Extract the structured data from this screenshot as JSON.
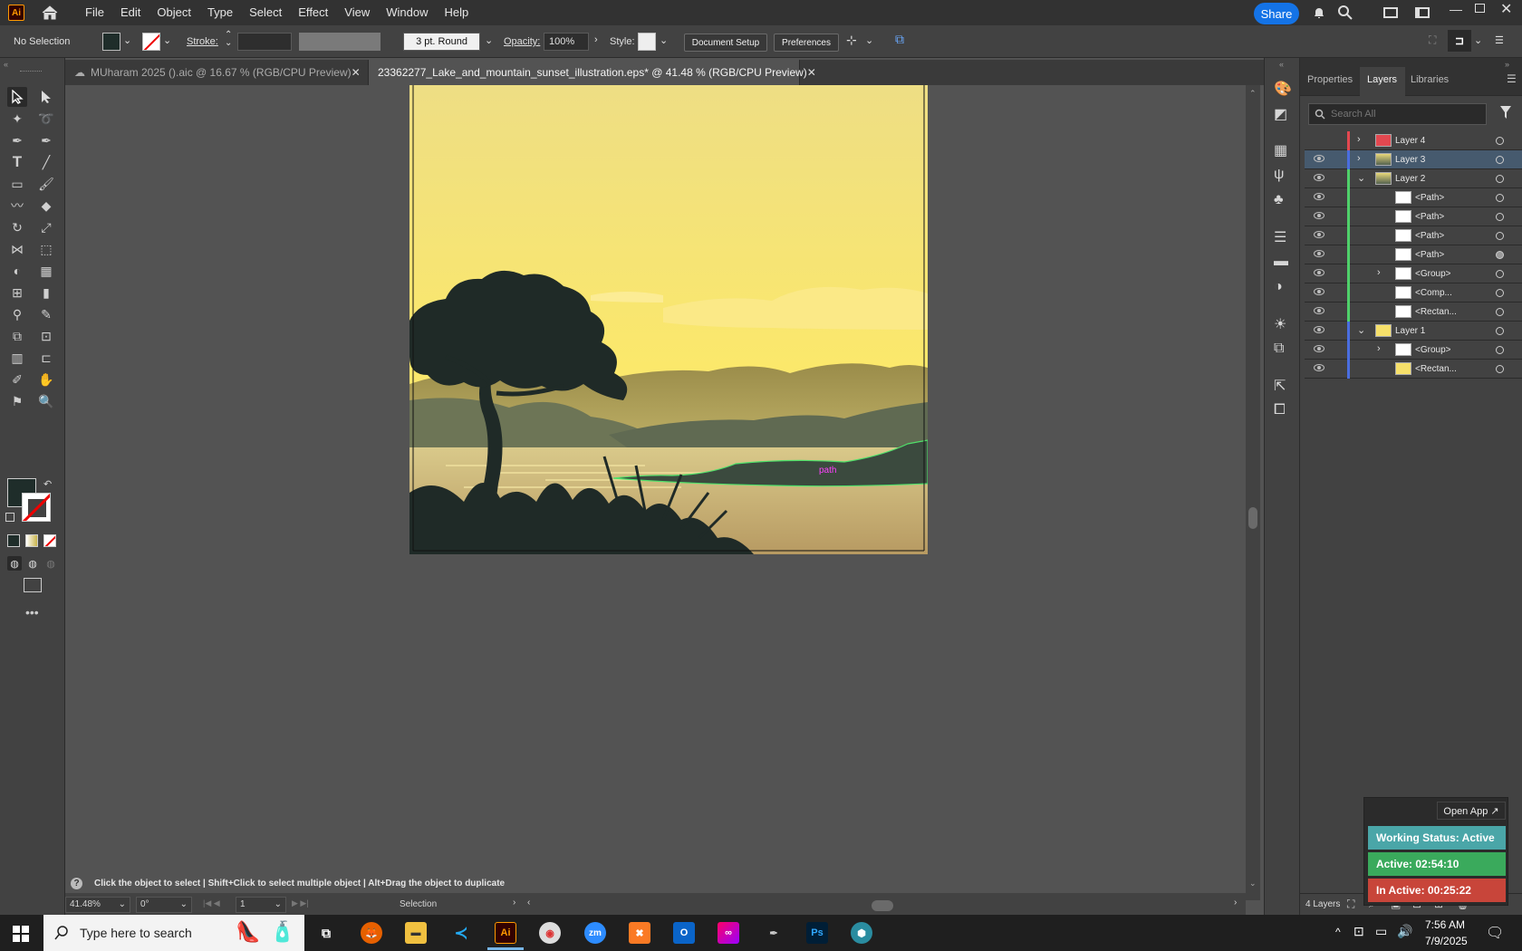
{
  "menubar": {
    "app_icon": "Ai",
    "items": [
      "File",
      "Edit",
      "Object",
      "Type",
      "Select",
      "Effect",
      "View",
      "Window",
      "Help"
    ],
    "share": "Share"
  },
  "controlbar": {
    "selection": "No Selection",
    "stroke_label": "Stroke:",
    "brush": "3 pt. Round",
    "opacity_label": "Opacity:",
    "opacity": "100%",
    "style_label": "Style:",
    "document_setup": "Document Setup",
    "preferences": "Preferences"
  },
  "tabs": [
    {
      "title": "MUharam 2025 ().aic @ 16.67 % (RGB/CPU Preview)",
      "active": false
    },
    {
      "title": "23362277_Lake_and_mountain_sunset_illustration.eps* @ 41.48 % (RGB/CPU Preview)",
      "active": true
    }
  ],
  "canvas": {
    "hover_label": "path"
  },
  "panel": {
    "tabs": [
      "Properties",
      "Layers",
      "Libraries"
    ],
    "active_tab": "Layers",
    "search_placeholder": "Search All",
    "layers": [
      {
        "name": "Layer 4",
        "color": "#e34850",
        "indent": 0,
        "expand": ">",
        "eye": false,
        "selected": false
      },
      {
        "name": "Layer 3",
        "color": "#4a6ee0",
        "indent": 0,
        "expand": ">",
        "eye": true,
        "selected": true
      },
      {
        "name": "Layer 2",
        "color": "#4fd16a",
        "indent": 0,
        "expand": "v",
        "eye": true,
        "selected": false
      },
      {
        "name": "<Path>",
        "color": "#4fd16a",
        "indent": 1,
        "expand": "",
        "eye": true,
        "selected": false
      },
      {
        "name": "<Path>",
        "color": "#4fd16a",
        "indent": 1,
        "expand": "",
        "eye": true,
        "selected": false
      },
      {
        "name": "<Path>",
        "color": "#4fd16a",
        "indent": 1,
        "expand": "",
        "eye": true,
        "selected": false
      },
      {
        "name": "<Path>",
        "color": "#4fd16a",
        "indent": 1,
        "expand": "",
        "eye": true,
        "selected": false
      },
      {
        "name": "<Group>",
        "color": "#4fd16a",
        "indent": 1,
        "expand": ">",
        "eye": true,
        "selected": false
      },
      {
        "name": "<Comp...",
        "color": "#4fd16a",
        "indent": 1,
        "expand": "",
        "eye": true,
        "selected": false
      },
      {
        "name": "<Rectan...",
        "color": "#4fd16a",
        "indent": 1,
        "expand": "",
        "eye": true,
        "selected": false
      },
      {
        "name": "Layer 1",
        "color": "#4a6ee0",
        "indent": 0,
        "expand": "v",
        "eye": true,
        "selected": false
      },
      {
        "name": "<Group>",
        "color": "#4a6ee0",
        "indent": 1,
        "expand": ">",
        "eye": true,
        "selected": false
      },
      {
        "name": "<Rectan...",
        "color": "#4a6ee0",
        "indent": 1,
        "expand": "",
        "eye": true,
        "selected": false
      }
    ],
    "footer": "4 Layers"
  },
  "statusbar": {
    "hint": "Click the object to select  |  Shift+Click to select multiple object  |  Alt+Drag the object to duplicate",
    "zoom": "41.48%",
    "rotation": "0°",
    "artboard": "1",
    "tool": "Selection"
  },
  "widget": {
    "open_app": "Open App ↗",
    "status": "Working Status: Active",
    "active": "Active: 02:54:10",
    "inactive": "In Active: 00:25:22"
  },
  "taskbar": {
    "search_placeholder": "Type here to search",
    "time": "7:56 AM",
    "date": "7/9/2025"
  },
  "colors": {
    "accent": "#1473e6",
    "status_teal": "#4aa6a8",
    "active_green": "#3aaa5c",
    "inactive_red": "#c8453a"
  }
}
